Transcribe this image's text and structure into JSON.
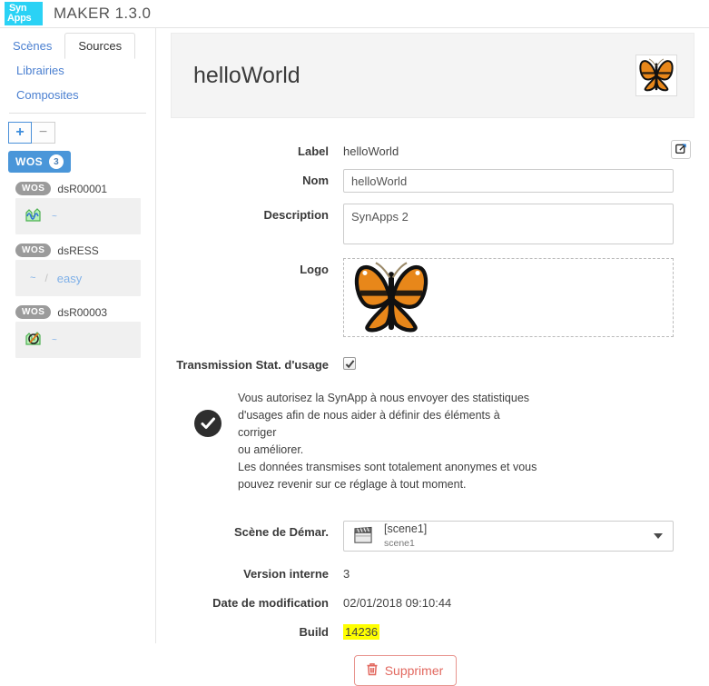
{
  "app": {
    "logo_line1": "Syn",
    "logo_line2": "Apps",
    "title": "MAKER 1.3.0",
    "accent_cyan": "#2ad2f5",
    "accent_blue": "#4a96d9"
  },
  "sidebar": {
    "tabs": [
      {
        "label": "Scènes",
        "active": false
      },
      {
        "label": "Sources",
        "active": true
      },
      {
        "label": "Librairies",
        "active": false
      },
      {
        "label": "Composites",
        "active": false
      }
    ],
    "toolbar": {
      "add_label": "+",
      "remove_label": "−"
    },
    "tree_root": {
      "badge": "WOS",
      "count": "3"
    },
    "tree_items": [
      {
        "badge": "WOS",
        "name": "dsR00001",
        "icon": "waveform-icon",
        "tilde": "~",
        "secondary": "",
        "separator": "",
        "link": ""
      },
      {
        "badge": "WOS",
        "name": "dsRESS",
        "icon": "",
        "tilde": "~",
        "separator": "/",
        "link": "easy"
      },
      {
        "badge": "WOS",
        "name": "dsR00003",
        "icon": "broken-link-icon",
        "tilde": "~",
        "secondary": "",
        "separator": "",
        "link": ""
      }
    ]
  },
  "hero": {
    "title": "helloWorld",
    "thumbnail_icon": "butterfly-icon"
  },
  "form": {
    "label_label": "Label",
    "label_value": "helloWorld",
    "edit_icon": "edit-square-icon",
    "nom_label": "Nom",
    "nom_value": "helloWorld",
    "description_label": "Description",
    "description_value": "SynApps 2",
    "logo_label": "Logo",
    "logo_icon": "butterfly-icon",
    "transmission_label": "Transmission Stat. d'usage",
    "transmission_checked": true,
    "notice_icon": "check-circle-icon",
    "notice_line1": "Vous autorisez la SynApp à nous envoyer des statistiques",
    "notice_line2": "d'usages afin de nous aider à définir des éléments à corriger",
    "notice_line3": "ou améliorer.",
    "notice_line4": "Les données transmises sont totalement anonymes et vous",
    "notice_line5": "pouvez revenir sur ce réglage à tout moment.",
    "scene_label": "Scène de Démar.",
    "scene_icon": "clapperboard-icon",
    "scene_value_primary": "[scene1]",
    "scene_value_secondary": "scene1",
    "version_label": "Version interne",
    "version_value": "3",
    "date_label": "Date de modification",
    "date_value": "02/01/2018 09:10:44",
    "build_label": "Build",
    "build_value": "14236",
    "build_highlight_color": "#ffff00",
    "delete_label": "Supprimer",
    "delete_icon": "trash-icon",
    "delete_color": "#e2685f"
  }
}
